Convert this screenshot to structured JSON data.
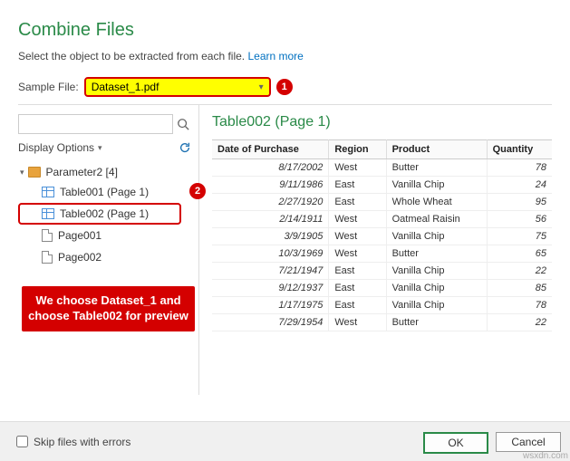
{
  "title": "Combine Files",
  "subtitle_text": "Select the object to be extracted from each file. ",
  "learn_more": "Learn more",
  "sample_file_label": "Sample File:",
  "sample_file_value": "Dataset_1.pdf",
  "badges": {
    "b1": "1",
    "b2": "2"
  },
  "display_options": "Display Options",
  "tree": {
    "root_label": "Parameter2 [4]",
    "items": [
      {
        "label": "Table001 (Page 1)",
        "kind": "table",
        "selected": false
      },
      {
        "label": "Table002 (Page 1)",
        "kind": "table",
        "selected": true
      },
      {
        "label": "Page001",
        "kind": "page",
        "selected": false
      },
      {
        "label": "Page002",
        "kind": "page",
        "selected": false
      }
    ]
  },
  "callout": "We choose Dataset_1 and choose Table002 for preview",
  "preview_title": "Table002 (Page 1)",
  "columns": [
    "Date of Purchase",
    "Region",
    "Product",
    "Quantity"
  ],
  "rows": [
    {
      "date": "8/17/2002",
      "region": "West",
      "product": "Butter",
      "qty": "78"
    },
    {
      "date": "9/11/1986",
      "region": "East",
      "product": "Vanilla Chip",
      "qty": "24"
    },
    {
      "date": "2/27/1920",
      "region": "East",
      "product": "Whole Wheat",
      "qty": "95"
    },
    {
      "date": "2/14/1911",
      "region": "West",
      "product": "Oatmeal Raisin",
      "qty": "56"
    },
    {
      "date": "3/9/1905",
      "region": "West",
      "product": "Vanilla Chip",
      "qty": "75"
    },
    {
      "date": "10/3/1969",
      "region": "West",
      "product": "Butter",
      "qty": "65"
    },
    {
      "date": "7/21/1947",
      "region": "East",
      "product": "Vanilla Chip",
      "qty": "22"
    },
    {
      "date": "9/12/1937",
      "region": "East",
      "product": "Vanilla Chip",
      "qty": "85"
    },
    {
      "date": "1/17/1975",
      "region": "East",
      "product": "Vanilla Chip",
      "qty": "78"
    },
    {
      "date": "7/29/1954",
      "region": "West",
      "product": "Butter",
      "qty": "22"
    }
  ],
  "skip_label": "Skip files with errors",
  "ok_label": "OK",
  "cancel_label": "Cancel",
  "watermark": "wsxdn.com"
}
